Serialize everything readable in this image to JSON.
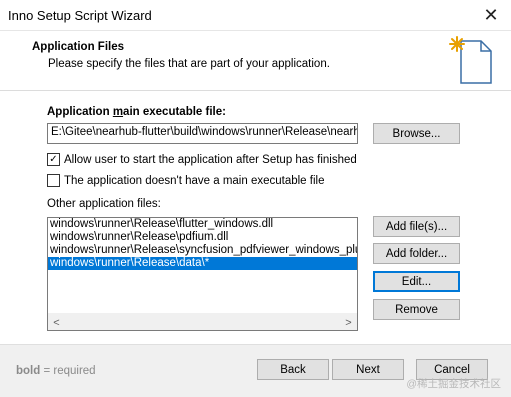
{
  "window": {
    "title": "Inno Setup Script Wizard",
    "close_glyph": "✕"
  },
  "header": {
    "title": "Application Files",
    "subtitle": "Please specify the files that are part of your application.",
    "icon": "wizard-page-icon"
  },
  "main_exe": {
    "label_pre": "Application ",
    "label_u": "m",
    "label_post": "ain executable file:",
    "value": "E:\\Gitee\\nearhub-flutter\\build\\windows\\runner\\Release\\nearhu",
    "browse_label": "Browse..."
  },
  "options": {
    "allow_start": {
      "label": "Allow user to start the application after Setup has finished",
      "checked": true
    },
    "no_main_exe": {
      "label": "The application doesn't have a main executable file",
      "checked": false
    }
  },
  "other_files": {
    "label": "Other application files:",
    "items": [
      "windows\\runner\\Release\\flutter_windows.dll",
      "windows\\runner\\Release\\pdfium.dll",
      "windows\\runner\\Release\\syncfusion_pdfviewer_windows_plugi",
      "windows\\runner\\Release\\data\\*"
    ],
    "selected_index": 3,
    "add_files_label": "Add file(s)...",
    "add_folder_label": "Add folder...",
    "edit_label": "Edit...",
    "remove_label": "Remove",
    "scroll_left_glyph": "<",
    "scroll_right_glyph": ">"
  },
  "footer": {
    "required_bold": "bold",
    "required_text": " = required",
    "back_label": "Back",
    "next_label": "Next",
    "cancel_label": "Cancel",
    "watermark": "@稀土掘金技术社区"
  },
  "colors": {
    "selection": "#0078d7",
    "footer_bg": "#f0f0f0",
    "accent_icon": "#e8a000"
  }
}
